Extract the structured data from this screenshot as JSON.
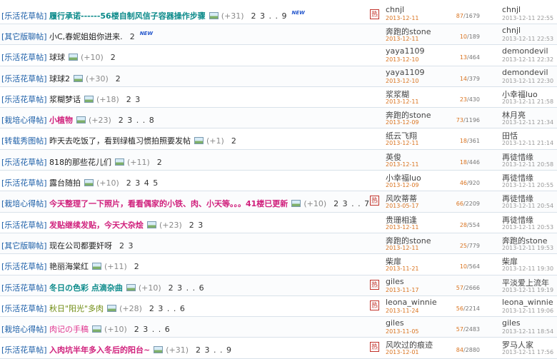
{
  "rows": [
    {
      "category": "[乐活花草帖]",
      "title": "履行承诺------56楼自制风信子容器操作步骤",
      "style": "c-teal",
      "replies": "(+31)",
      "pages": "2 3 . . 9",
      "is_new": true,
      "hot": true,
      "author": "chnjl",
      "author_date": "2013-12-11",
      "reply_count": "87",
      "view_count": "1679",
      "last_author": "chnjl",
      "last_date": "2013-12-11 22:55"
    },
    {
      "category": "[其它版聊帖]",
      "title": "小C,春妮姐姐你进来.",
      "style": "",
      "replies": "",
      "pages": "2",
      "is_new": true,
      "hot": false,
      "author": "奔跑的stone",
      "author_date": "2013-12-11",
      "reply_count": "10",
      "view_count": "189",
      "last_author": "chnjl",
      "last_date": "2013-12-11 22:53"
    },
    {
      "category": "[乐活花草帖]",
      "title": "球球",
      "style": "",
      "replies": "(+10)",
      "pages": "2",
      "is_new": false,
      "hot": false,
      "author": "yaya1109",
      "author_date": "2013-12-10",
      "reply_count": "13",
      "view_count": "464",
      "last_author": "demondevil",
      "last_date": "2013-12-11 22:32"
    },
    {
      "category": "[乐活花草帖]",
      "title": "球球2",
      "style": "",
      "replies": "(+30)",
      "pages": "2",
      "is_new": false,
      "hot": false,
      "author": "yaya1109",
      "author_date": "2013-12-10",
      "reply_count": "14",
      "view_count": "379",
      "last_author": "demondevil",
      "last_date": "2013-12-11 22:30"
    },
    {
      "category": "[乐活花草帖]",
      "title": "浆糊梦话",
      "style": "",
      "replies": "(+18)",
      "pages": "2 3",
      "is_new": false,
      "hot": false,
      "author": "浆浆糊",
      "author_date": "2013-12-11",
      "reply_count": "23",
      "view_count": "430",
      "last_author": "小幸福luo",
      "last_date": "2013-12-11 21:58"
    },
    {
      "category": "[栽培心得帖]",
      "title": "小植物",
      "style": "c-magenta",
      "replies": "(+23)",
      "pages": "2 3 . . 8",
      "is_new": false,
      "hot": false,
      "author": "奔跑的stone",
      "author_date": "2013-12-09",
      "reply_count": "73",
      "view_count": "1196",
      "last_author": "林月亮",
      "last_date": "2013-12-11 21:34"
    },
    {
      "category": "[转载秀图帖]",
      "title": "昨天去吃饭了，看到绿植习惯拍照要发帖",
      "style": "",
      "replies": "(+1)",
      "pages": "2",
      "is_new": false,
      "hot": false,
      "author": "纸云飞翔",
      "author_date": "2013-12-11",
      "reply_count": "18",
      "view_count": "361",
      "last_author": "田恬",
      "last_date": "2013-12-11 21:14"
    },
    {
      "category": "[乐活花草帖]",
      "title": "818的那些花儿们",
      "style": "",
      "replies": "(+11)",
      "pages": "2",
      "is_new": false,
      "hot": false,
      "author": "英俊",
      "author_date": "2013-12-11",
      "reply_count": "18",
      "view_count": "446",
      "last_author": "再徒惜缘",
      "last_date": "2013-12-11 20:58"
    },
    {
      "category": "[乐活花草帖]",
      "title": "露台随拍",
      "style": "",
      "replies": "(+10)",
      "pages": "2 3 4 5",
      "is_new": false,
      "hot": false,
      "author": "小幸福luo",
      "author_date": "2013-12-09",
      "reply_count": "46",
      "view_count": "920",
      "last_author": "再徒惜缘",
      "last_date": "2013-12-11 20:55"
    },
    {
      "category": "[栽培心得帖]",
      "title": "今天整理了一下照片，看看偶家的小铁、肉、小天等。。。41楼已更新",
      "style": "c-magenta",
      "replies": "(+10)",
      "pages": "2 3 . . 7",
      "is_new": false,
      "hot": true,
      "author": "风吹蒂蒂",
      "author_date": "2013-05-17",
      "reply_count": "66",
      "view_count": "2209",
      "last_author": "再徒惜缘",
      "last_date": "2013-12-11 20:54"
    },
    {
      "category": "[乐活花草帖]",
      "title": "发贴继续发贴，今天大杂烩",
      "style": "c-magenta",
      "replies": "(+23)",
      "pages": "2 3",
      "is_new": false,
      "hot": false,
      "author": "贵珊相逢",
      "author_date": "2013-12-11",
      "reply_count": "28",
      "view_count": "554",
      "last_author": "再徒惜缘",
      "last_date": "2013-12-11 20:53"
    },
    {
      "category": "[其它版聊帖]",
      "title": "现在公司都要奸呀",
      "style": "",
      "replies": "",
      "pages": "2 3",
      "is_new": false,
      "hot": false,
      "author": "奔跑的stone",
      "author_date": "2013-12-11",
      "reply_count": "25",
      "view_count": "779",
      "last_author": "奔跑的stone",
      "last_date": "2013-12-11 19:53"
    },
    {
      "category": "[乐活花草帖]",
      "title": "艳丽海棠红",
      "style": "",
      "replies": "(+11)",
      "pages": "2",
      "is_new": false,
      "hot": false,
      "author": "柴扉",
      "author_date": "2013-11-21",
      "reply_count": "10",
      "view_count": "564",
      "last_author": "柴扉",
      "last_date": "2013-12-11 19:30"
    },
    {
      "category": "[乐活花草帖]",
      "title": "冬日の色彩  点滴杂曲",
      "style": "c-teal",
      "replies": "(+10)",
      "pages": "2 3 . . 6",
      "is_new": false,
      "hot": true,
      "author": "giles",
      "author_date": "2013-11-17",
      "reply_count": "57",
      "view_count": "2666",
      "last_author": "平淡爱上流年",
      "last_date": "2013-12-11 19:19"
    },
    {
      "category": "[乐活花草帖]",
      "title": "秋日\"阳光\"多肉",
      "style": "c-olive",
      "replies": "(+28)",
      "pages": "2 3 . . 6",
      "is_new": false,
      "hot": true,
      "author": "leona_winnie",
      "author_date": "2013-11-24",
      "reply_count": "56",
      "view_count": "2214",
      "last_author": "leona_winnie",
      "last_date": "2013-12-11 19:06"
    },
    {
      "category": "[栽培心得帖]",
      "title": "肉记の手稿",
      "style": "c-pink",
      "replies": "(+10)",
      "pages": "2 3 . . 6",
      "is_new": false,
      "hot": false,
      "author": "giles",
      "author_date": "2013-11-05",
      "reply_count": "57",
      "view_count": "2483",
      "last_author": "giles",
      "last_date": "2013-12-11 18:54"
    },
    {
      "category": "[乐活花草帖]",
      "title": "入肉坑半年多入冬后的阳台~",
      "style": "c-magenta",
      "replies": "(+31)",
      "pages": "2 3 . . 9",
      "is_new": false,
      "hot": true,
      "author": "风吹过的痕迹",
      "author_date": "2013-12-01",
      "reply_count": "84",
      "view_count": "2880",
      "last_author": "罗马人家",
      "last_date": "2013-12-11 17:56"
    }
  ],
  "labels": {
    "new_badge": "NEW",
    "hot_badge": "热",
    "image_icon": "image-attachment-icon"
  }
}
